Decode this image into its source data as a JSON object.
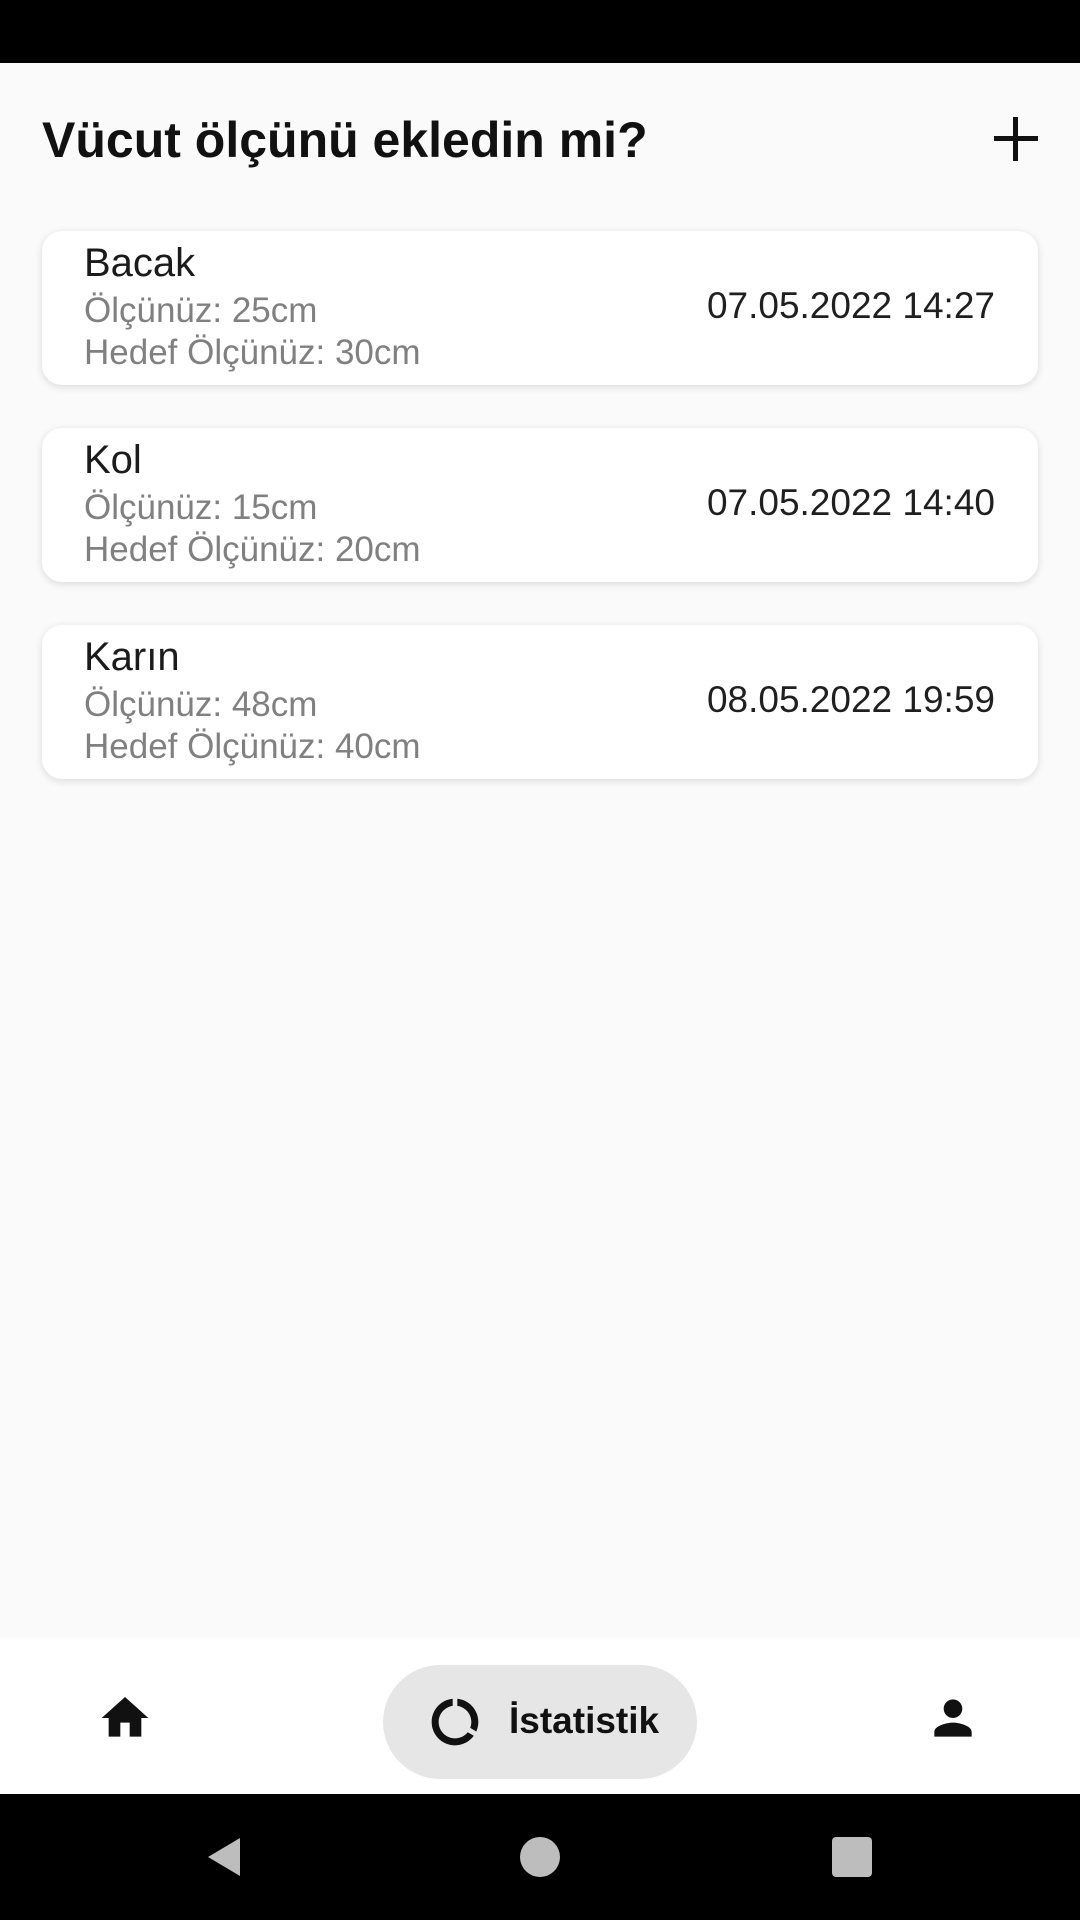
{
  "header": {
    "title": "Vücut ölçünü ekledin mi?",
    "add_icon": "plus-icon"
  },
  "measurements": [
    {
      "name": "Bacak",
      "measure": "Ölçünüz: 25cm",
      "target": "Hedef Ölçünüz: 30cm",
      "date": "07.05.2022 14:27"
    },
    {
      "name": "Kol",
      "measure": "Ölçünüz: 15cm",
      "target": "Hedef Ölçünüz: 20cm",
      "date": "07.05.2022 14:40"
    },
    {
      "name": "Karın",
      "measure": "Ölçünüz: 48cm",
      "target": "Hedef Ölçünüz: 40cm",
      "date": "08.05.2022 19:59"
    }
  ],
  "bottom_nav": {
    "home_icon": "home-icon",
    "stats_label": "İstatistik",
    "stats_icon": "donut-chart-icon",
    "profile_icon": "person-icon"
  },
  "colors": {
    "background": "#fafafa",
    "card": "#ffffff",
    "secondary_text": "#808080",
    "nav_active_pill": "#e6e6e6"
  }
}
